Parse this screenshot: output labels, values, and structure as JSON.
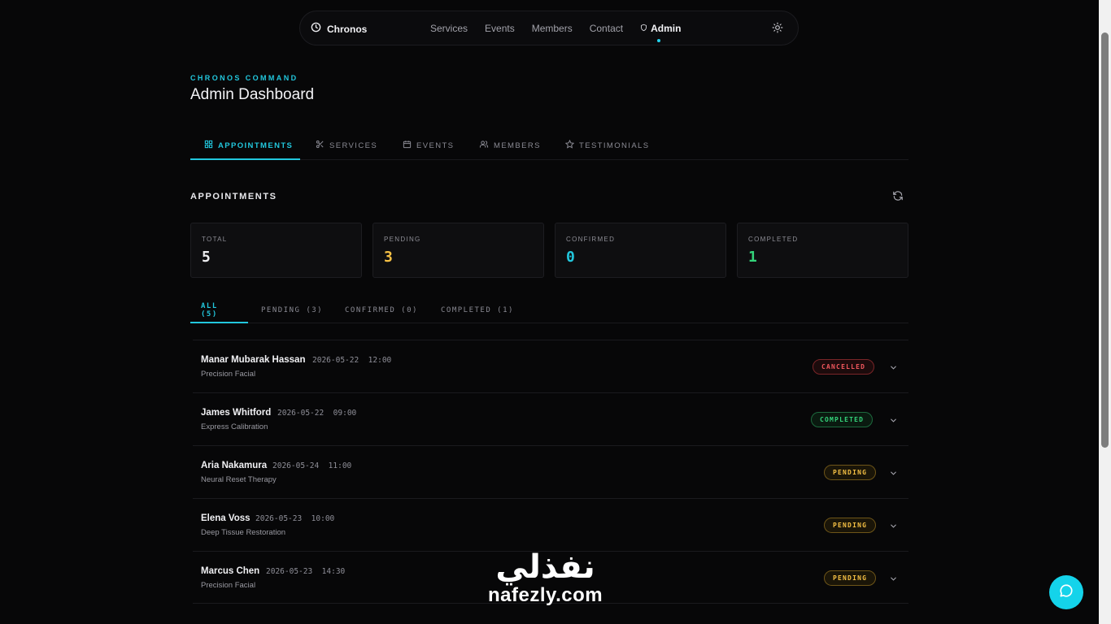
{
  "nav": {
    "brand": "Chronos",
    "links": [
      "Services",
      "Events",
      "Members",
      "Contact"
    ],
    "admin": "Admin"
  },
  "header": {
    "eyebrow": "CHRONOS COMMAND",
    "title": "Admin Dashboard"
  },
  "tabs": [
    {
      "label": "APPOINTMENTS",
      "icon": "grid-icon",
      "active": true
    },
    {
      "label": "SERVICES",
      "icon": "scissors-icon",
      "active": false
    },
    {
      "label": "EVENTS",
      "icon": "calendar-icon",
      "active": false
    },
    {
      "label": "MEMBERS",
      "icon": "users-icon",
      "active": false
    },
    {
      "label": "TESTIMONIALS",
      "icon": "star-icon",
      "active": false
    }
  ],
  "section": {
    "title": "APPOINTMENTS"
  },
  "stats": [
    {
      "label": "TOTAL",
      "value": "5",
      "color": "#ededf0"
    },
    {
      "label": "PENDING",
      "value": "3",
      "color": "#f5c044"
    },
    {
      "label": "CONFIRMED",
      "value": "0",
      "color": "#22c7dd"
    },
    {
      "label": "COMPLETED",
      "value": "1",
      "color": "#34d37a"
    }
  ],
  "filters": [
    {
      "label": "ALL (5)",
      "active": true
    },
    {
      "label": "PENDING (3)",
      "active": false
    },
    {
      "label": "CONFIRMED (0)",
      "active": false
    },
    {
      "label": "COMPLETED (1)",
      "active": false
    }
  ],
  "appointments": [
    {
      "name": "Manar Mubarak Hassan",
      "date": "2026-05-22",
      "time": "12:00",
      "service": "Precision Facial",
      "status": "CANCELLED"
    },
    {
      "name": "James Whitford",
      "date": "2026-05-22",
      "time": "09:00",
      "service": "Express Calibration",
      "status": "COMPLETED"
    },
    {
      "name": "Aria Nakamura",
      "date": "2026-05-24",
      "time": "11:00",
      "service": "Neural Reset Therapy",
      "status": "PENDING"
    },
    {
      "name": "Elena Voss",
      "date": "2026-05-23",
      "time": "10:00",
      "service": "Deep Tissue Restoration",
      "status": "PENDING"
    },
    {
      "name": "Marcus Chen",
      "date": "2026-05-23",
      "time": "14:30",
      "service": "Precision Facial",
      "status": "PENDING"
    }
  ],
  "status_colors": {
    "CANCELLED": {
      "text": "#f0575d",
      "border": "#7a2528",
      "bg": "#1c0b0c"
    },
    "COMPLETED": {
      "text": "#34d37a",
      "border": "#1d6a3e",
      "bg": "#0a1a10"
    },
    "PENDING": {
      "text": "#f5c044",
      "border": "#6e5518",
      "bg": "#1a1508"
    }
  },
  "watermark": {
    "arabic": "نفذلي",
    "latin": "nafezly.com"
  },
  "accent": "#22c7dd"
}
